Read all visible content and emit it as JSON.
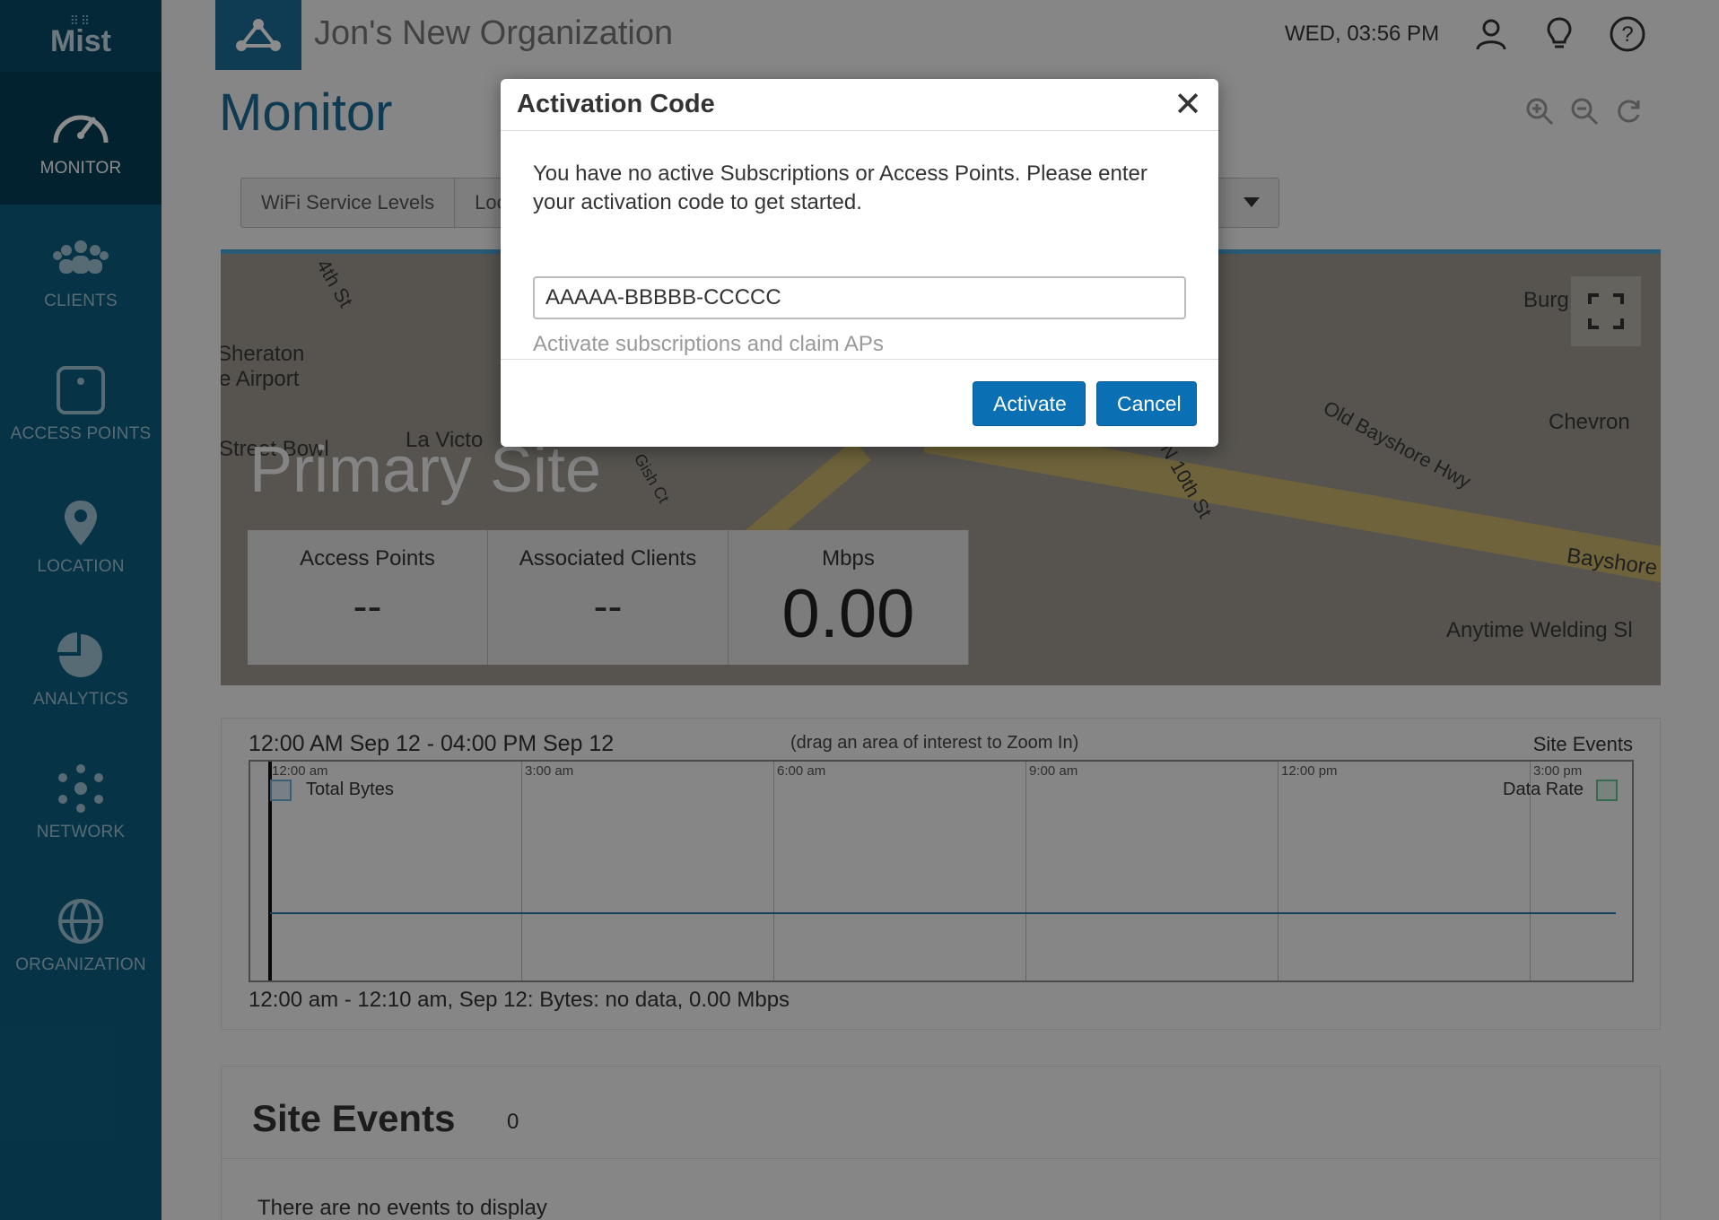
{
  "sidebar": {
    "logo": "Mist",
    "items": [
      {
        "label": "MONITOR",
        "icon": "gauge-icon",
        "active": true
      },
      {
        "label": "CLIENTS",
        "icon": "people-icon"
      },
      {
        "label": "ACCESS POINTS",
        "icon": "access-point-icon"
      },
      {
        "label": "LOCATION",
        "icon": "map-pin-icon"
      },
      {
        "label": "ANALYTICS",
        "icon": "pie-chart-icon"
      },
      {
        "label": "NETWORK",
        "icon": "network-icon"
      },
      {
        "label": "ORGANIZATION",
        "icon": "globe-icon"
      }
    ]
  },
  "header": {
    "org_name": "Jon's New Organization",
    "clock": "WED, 03:56 PM"
  },
  "page": {
    "title": "Monitor",
    "filters": [
      "WiFi Service Levels",
      "Loc"
    ]
  },
  "map": {
    "site_name": "Primary Site",
    "labels": [
      "Sheraton",
      "e Airport",
      "Street Bowl",
      "La Victo",
      "Burg",
      "Chevron",
      "Old Bayshore Hwy",
      "N 10th St",
      "Bayshore",
      "Anytime Welding Sl",
      "4th St",
      "Gish Ct"
    ],
    "stats": [
      {
        "label": "Access Points",
        "value": "--"
      },
      {
        "label": "Associated Clients",
        "value": "--"
      },
      {
        "label": "Mbps",
        "value": "0.00"
      }
    ]
  },
  "timeline": {
    "range": "12:00 AM Sep 12 - 04:00 PM Sep 12",
    "hint": "(drag an area of interest to Zoom In)",
    "site_events": "Site Events",
    "ticks": [
      "12:00 am",
      "3:00 am",
      "6:00 am",
      "9:00 am",
      "12:00 pm",
      "3:00 pm"
    ],
    "legend_left": "Total Bytes",
    "legend_right": "Data Rate",
    "footer": "12:00 am - 12:10 am, Sep 12: Bytes: no data, 0.00 Mbps"
  },
  "events": {
    "title": "Site Events",
    "count": "0",
    "empty": "There are no events to display"
  },
  "modal": {
    "title": "Activation Code",
    "close": "✕",
    "message": "You have no active Subscriptions or Access Points. Please enter your activation code to get started.",
    "input_value": "AAAAA-BBBBB-CCCCC",
    "help": "Activate subscriptions and claim APs",
    "activate_label": "Activate",
    "cancel_label": "Cancel"
  },
  "colors": {
    "sidebar": "#0d5e80",
    "accent": "#1b6a95",
    "button": "#0a6fb3"
  }
}
